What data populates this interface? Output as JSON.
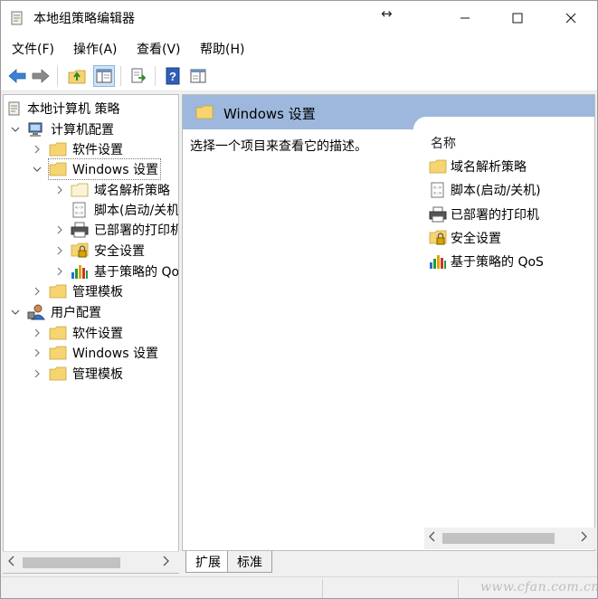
{
  "window": {
    "title": "本地组策略编辑器",
    "resize_glyph": "↔"
  },
  "menu": {
    "file": "文件(F)",
    "action": "操作(A)",
    "view": "查看(V)",
    "help": "帮助(H)"
  },
  "toolbar": {
    "icons": [
      "back-arrow-icon",
      "forward-arrow-icon",
      "up-folder-icon",
      "show-hide-tree-icon",
      "export-list-icon",
      "help-icon",
      "show-hide-action-pane-icon"
    ]
  },
  "tree": {
    "root": "本地计算机 策略",
    "computer_config": "计算机配置",
    "software_settings": "软件设置",
    "windows_settings": "Windows 设置",
    "dns_policy": "域名解析策略",
    "scripts": "脚本(启动/关机)",
    "printers": "已部署的打印机",
    "security": "安全设置",
    "qos": "基于策略的 QoS",
    "admin_templates": "管理模板",
    "user_config": "用户配置",
    "user_software": "软件设置",
    "user_windows": "Windows 设置",
    "user_admin": "管理模板"
  },
  "right": {
    "header_title": "Windows 设置",
    "description": "选择一个项目来查看它的描述。",
    "column_name": "名称",
    "items": [
      "域名解析策略",
      "脚本(启动/关机)",
      "已部署的打印机",
      "安全设置",
      "基于策略的 QoS"
    ]
  },
  "tabs": {
    "extended": "扩展",
    "standard": "标准"
  },
  "watermark": "www.cfan.com.cn",
  "colors": {
    "header_blue": "#9db8dc",
    "folder_yellow": "#f5d471",
    "selection_outline": "#7a7a7a"
  }
}
